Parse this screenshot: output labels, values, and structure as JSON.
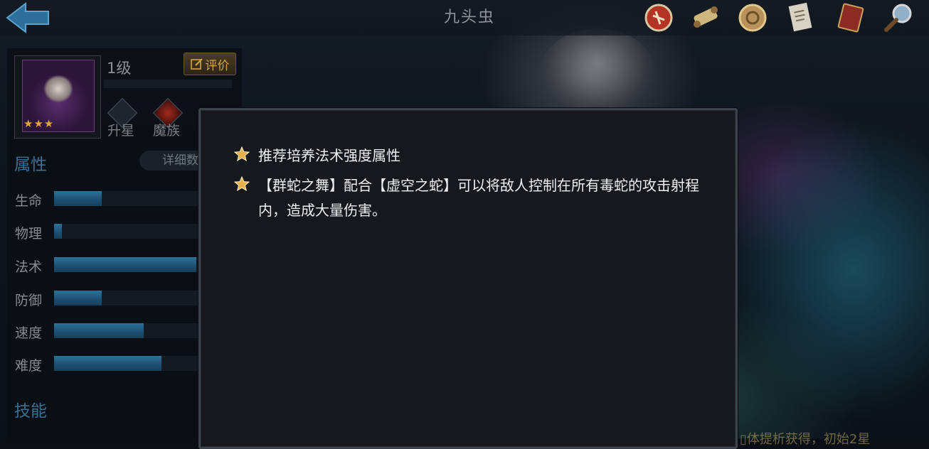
{
  "header": {
    "title": "九头虫",
    "icons": [
      "war-drum-icon",
      "scroll-icon",
      "coin-icon",
      "document-icon",
      "book-icon",
      "magnifier-icon"
    ]
  },
  "hero": {
    "level": "1级",
    "review_label": "评价",
    "stars": "★★★",
    "badges": [
      {
        "label": "升星"
      },
      {
        "label": "魔族"
      }
    ]
  },
  "attributes": {
    "title": "属性",
    "detail_label": "详细数",
    "items": [
      {
        "label": "生命",
        "value": 0.32
      },
      {
        "label": "物理",
        "value": 0.05
      },
      {
        "label": "法术",
        "value": 0.95
      },
      {
        "label": "防御",
        "value": 0.32
      },
      {
        "label": "速度",
        "value": 0.6
      },
      {
        "label": "难度",
        "value": 0.72
      }
    ]
  },
  "skills": {
    "title": "技能"
  },
  "popup": {
    "tips": [
      "推荐培养法术强度属性",
      "【群蛇之舞】配合【虚空之蛇】可以将敌人控制在所有毒蛇的攻击射程内，造成大量伤害。"
    ]
  },
  "bottom_text": "▯体提析获得，初始2星",
  "colors": {
    "accent_blue": "#2d7299",
    "star_gold": "#e0a63a",
    "popup_bg": "#15181d"
  }
}
